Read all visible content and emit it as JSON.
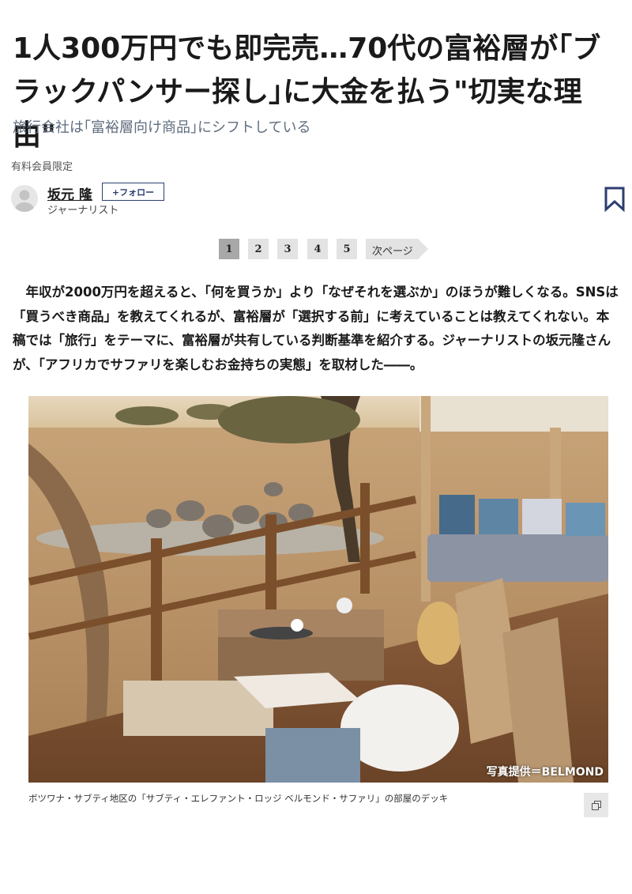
{
  "article": {
    "title": "1人300万円でも即完売…70代の富裕層が｢ブラックパンサー探し｣に大金を払う\"切実な理由\"",
    "subtitle": "旅行会社は｢富裕層向け商品｣にシフトしている",
    "member_label": "有料会員限定"
  },
  "author": {
    "name": "坂元 隆",
    "role": "ジャーナリスト",
    "follow_label": "+フォロー"
  },
  "icons": {
    "bookmark": "bookmark-icon",
    "avatar": "user-avatar-icon",
    "copy": "copy-icon"
  },
  "pagination": {
    "pages": [
      "1",
      "2",
      "3",
      "4",
      "5"
    ],
    "current": "1",
    "next_label": "次ページ"
  },
  "lead": "年収が2000万円を超えると、「何を買うか」より「なぜそれを選ぶか」のほうが難しくなる。SNSは「買うべき商品」を教えてくれるが、富裕層が「選択する前」に考えていることは教えてくれない。本稿では「旅行」をテーマに、富裕層が共有している判断基準を紹介する。ジャーナリストの坂元隆さんが、「アフリカでサファリを楽しむお金持ちの実態」を取材した――。",
  "photo": {
    "credit": "写真提供＝BELMOND",
    "caption": "ボツワナ・サブティ地区の「サブティ・エレファント・ロッジ ベルモンド・サファリ」の部屋のデッキ"
  },
  "colors": {
    "accent": "#2c3e70",
    "subtitle": "#5f6d7e",
    "page_current": "#a8a8a8",
    "page_default": "#e3e3e3"
  }
}
